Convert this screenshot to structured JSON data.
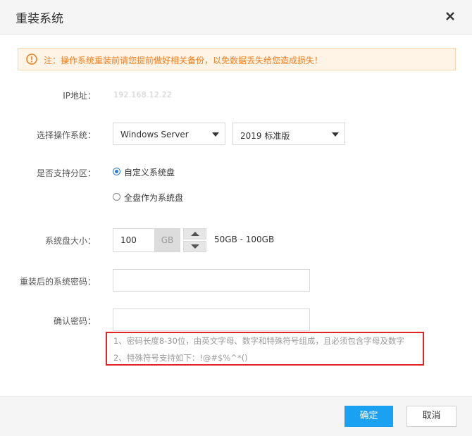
{
  "dialog": {
    "title": "重装系统"
  },
  "notice": {
    "text": "注：操作系统重装前请您提前做好相关备份，以免数据丢失给您造成损失！",
    "color": "#f07d1a"
  },
  "form": {
    "ip_label": "IP地址：",
    "ip_value": "192.168.12.22",
    "os_label": "选择操作系统：",
    "os_type_value": "Windows Server",
    "os_version_value": "2019 标准版",
    "partition_label": "是否支持分区：",
    "partition_options": [
      {
        "label": "自定义系统盘",
        "checked": true
      },
      {
        "label": "全盘作为系统盘",
        "checked": false
      }
    ],
    "disk_label": "系统盘大小：",
    "disk_value": "100",
    "disk_unit": "GB",
    "disk_range": "50GB  -  100GB",
    "password_label": "重装后的系统密码：",
    "password_value": "",
    "confirm_label": "确认密码：",
    "confirm_value": ""
  },
  "hints": [
    "1、密码长度8-30位，由英文字母、数字和特殊符号组成，且必须包含字母及数字",
    "2、特殊符号支持如下：!@#$%^*()"
  ],
  "footer": {
    "confirm_label": "确定",
    "cancel_label": "取消"
  },
  "colors": {
    "primary": "#1aa1f2",
    "radio_accent": "#2f7bd8",
    "highlight_border": "#e0262b"
  },
  "icons": {
    "close": "close-icon",
    "warning": "warning-icon"
  }
}
